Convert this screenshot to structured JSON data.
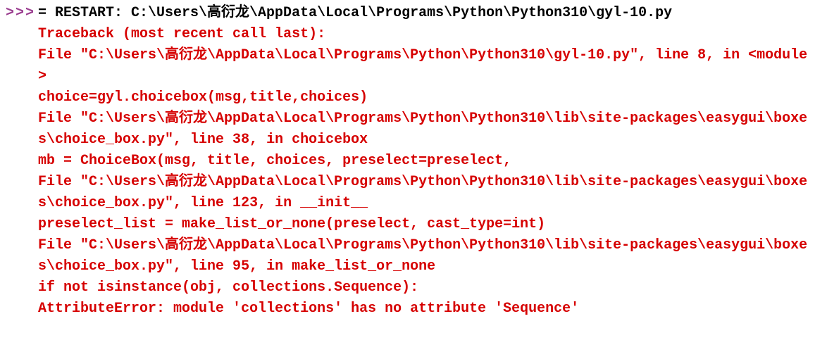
{
  "prompt": ">>>",
  "restart": "= RESTART: C:\\Users\\高衍龙\\AppData\\Local\\Programs\\Python\\Python310\\gyl-10.py",
  "traceback": [
    "Traceback (most recent call last):",
    "  File \"C:\\Users\\高衍龙\\AppData\\Local\\Programs\\Python\\Python310\\gyl-10.py\", line 8, in <module>",
    "    choice=gyl.choicebox(msg,title,choices)",
    "  File \"C:\\Users\\高衍龙\\AppData\\Local\\Programs\\Python\\Python310\\lib\\site-packages\\easygui\\boxes\\choice_box.py\", line 38, in choicebox",
    "    mb = ChoiceBox(msg, title, choices, preselect=preselect,",
    "  File \"C:\\Users\\高衍龙\\AppData\\Local\\Programs\\Python\\Python310\\lib\\site-packages\\easygui\\boxes\\choice_box.py\", line 123, in __init__",
    "    preselect_list = make_list_or_none(preselect, cast_type=int)",
    "  File \"C:\\Users\\高衍龙\\AppData\\Local\\Programs\\Python\\Python310\\lib\\site-packages\\easygui\\boxes\\choice_box.py\", line 95, in make_list_or_none",
    "    if not isinstance(obj, collections.Sequence):",
    "AttributeError: module 'collections' has no attribute 'Sequence'"
  ]
}
